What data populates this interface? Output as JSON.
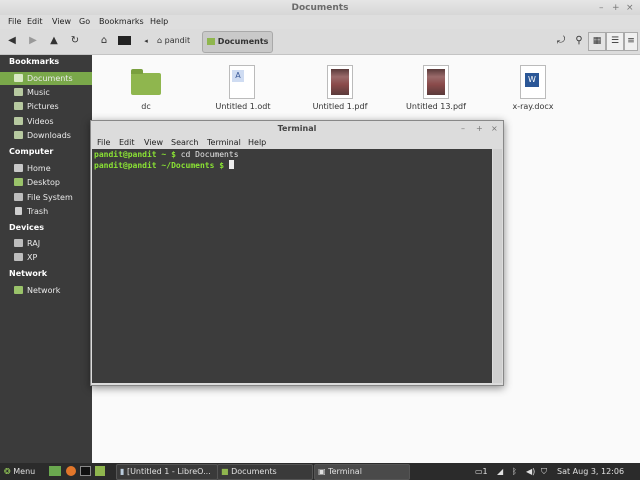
{
  "window": {
    "title": "Documents"
  },
  "menubar": [
    "File",
    "Edit",
    "View",
    "Go",
    "Bookmarks",
    "Help"
  ],
  "breadcrumb": {
    "user": "pandit",
    "current": "Documents"
  },
  "sidebar": {
    "bookmarks_title": "Bookmarks",
    "bookmarks": [
      {
        "label": "Documents",
        "icon": "folder-documents-icon",
        "selected": true
      },
      {
        "label": "Music",
        "icon": "folder-music-icon"
      },
      {
        "label": "Pictures",
        "icon": "folder-pictures-icon"
      },
      {
        "label": "Videos",
        "icon": "folder-videos-icon"
      },
      {
        "label": "Downloads",
        "icon": "folder-downloads-icon"
      }
    ],
    "computer_title": "Computer",
    "computer": [
      {
        "label": "Home",
        "icon": "home-icon"
      },
      {
        "label": "Desktop",
        "icon": "desktop-icon"
      },
      {
        "label": "File System",
        "icon": "drive-icon"
      },
      {
        "label": "Trash",
        "icon": "trash-icon"
      }
    ],
    "devices_title": "Devices",
    "devices": [
      {
        "label": "RAJ",
        "icon": "drive-icon"
      },
      {
        "label": "XP",
        "icon": "drive-icon"
      }
    ],
    "network_title": "Network",
    "network": [
      {
        "label": "Network",
        "icon": "network-icon"
      }
    ]
  },
  "files": [
    {
      "name": "dc",
      "type": "folder"
    },
    {
      "name": "Untitled 1.odt",
      "type": "odt"
    },
    {
      "name": "Untitled 1.pdf",
      "type": "pdf"
    },
    {
      "name": "Untitled 13.pdf",
      "type": "pdf"
    },
    {
      "name": "x-ray.docx",
      "type": "docx"
    }
  ],
  "terminal": {
    "title": "Terminal",
    "menu": [
      "File",
      "Edit",
      "View",
      "Search",
      "Terminal",
      "Help"
    ],
    "lines": [
      {
        "prompt": "pandit@pandit ~ $",
        "command": " cd Documents"
      },
      {
        "prompt": "pandit@pandit ~/Documents $",
        "command": " "
      }
    ]
  },
  "panel": {
    "menu_label": "Menu",
    "tasks": [
      "[Untitled 1 - LibreO...",
      "Documents",
      "Terminal"
    ],
    "clock": "Sat Aug 3, 12:06"
  },
  "colors": {
    "accent": "#7aa84a",
    "terminal_bg": "#3c3c3c",
    "prompt": "#8ae234"
  }
}
